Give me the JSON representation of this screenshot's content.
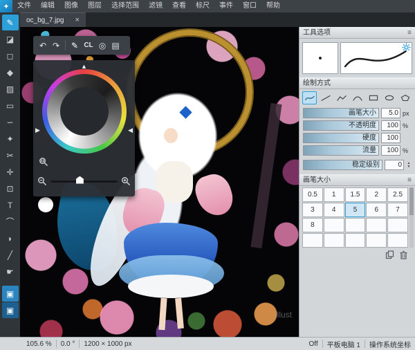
{
  "colors": {
    "accent": "#2d9fd8",
    "panel_bg": "#d2d6d9",
    "dark_ui": "#34383c",
    "canvas_bg": "#050507"
  },
  "menu": {
    "app_icon_glyph": "✦",
    "items": [
      "文件",
      "编辑",
      "图像",
      "图层",
      "选择范围",
      "滤镜",
      "查看",
      "标尺",
      "事件",
      "窗口",
      "帮助"
    ]
  },
  "tab": {
    "title": "oc_bg_7.jpg",
    "close_glyph": "×"
  },
  "tools": [
    {
      "name": "brush",
      "glyph": "✎"
    },
    {
      "name": "eraser",
      "glyph": "◪"
    },
    {
      "name": "pen-square",
      "glyph": "◻"
    },
    {
      "name": "bucket",
      "glyph": "◆"
    },
    {
      "name": "gradient",
      "glyph": "▨"
    },
    {
      "name": "select-rect",
      "glyph": "▭"
    },
    {
      "name": "lasso",
      "glyph": "∽"
    },
    {
      "name": "magic-wand",
      "glyph": "✦"
    },
    {
      "name": "scissors",
      "glyph": "✂"
    },
    {
      "name": "move",
      "glyph": "✛"
    },
    {
      "name": "transform",
      "glyph": "⊡"
    },
    {
      "name": "text",
      "glyph": "T"
    },
    {
      "name": "curve",
      "glyph": "⌒"
    },
    {
      "name": "eyedropper",
      "glyph": "◗"
    },
    {
      "name": "divide",
      "glyph": "╱"
    },
    {
      "name": "hand",
      "glyph": "☛"
    },
    {
      "name": "panel-snap-1",
      "glyph": "▣"
    },
    {
      "name": "panel-snap-2",
      "glyph": "▣"
    }
  ],
  "float_toolbar": {
    "undo": "↶",
    "redo": "↷",
    "pen": "✎",
    "cl": "CL",
    "target": "◎",
    "screen": "▤"
  },
  "color_panel": {
    "pointer": "▲",
    "left_arrow": "▶",
    "right_arrow": "◀"
  },
  "tool_options": {
    "title": "工具选项",
    "menu_glyph": "≡",
    "draw_mode_title": "绘制方式",
    "sliders": [
      {
        "label": "画笔大小",
        "value": "5.0",
        "unit": "px"
      },
      {
        "label": "不透明度",
        "value": "100",
        "unit": "%"
      },
      {
        "label": "硬度",
        "value": "100",
        "unit": ""
      },
      {
        "label": "流量",
        "value": "100",
        "unit": "%"
      }
    ],
    "stabilizer": {
      "label": "稳定级别",
      "value": "0",
      "up": "▲",
      "down": "▼"
    }
  },
  "brush_panel": {
    "title": "画笔大小",
    "menu_glyph": "≡",
    "sizes": [
      "0.5",
      "1",
      "1.5",
      "2",
      "2.5",
      "3",
      "4",
      "5",
      "6",
      "7",
      "8",
      "",
      "",
      "",
      "",
      "",
      "",
      "",
      "",
      ""
    ]
  },
  "status_bar": {
    "zoom": "105.6 %",
    "rotation": "0.0 °",
    "size": "1200 × 1000 px",
    "pen_pressure": "Off",
    "tablet": "平板电脑 1",
    "coords": "操作系统坐标"
  },
  "canvas": {
    "watermark": "Illust"
  }
}
